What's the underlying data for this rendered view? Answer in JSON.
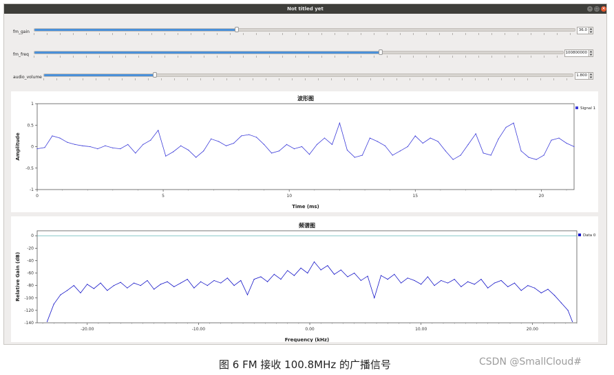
{
  "window": {
    "title": "Not titled yet"
  },
  "controls": [
    {
      "label": "fm_gain",
      "value": "36.0",
      "fraction": 0.374
    },
    {
      "label": "fm_freq",
      "value": "100800000",
      "fraction": 0.655
    },
    {
      "label": "audio_volume",
      "value": "1.800",
      "fraction": 0.209
    }
  ],
  "chart_data": [
    {
      "type": "line",
      "title": "波形图",
      "xlabel": "Time (ms)",
      "ylabel": "Amplitude",
      "xlim": [
        0,
        21.3
      ],
      "ylim": [
        -1,
        1
      ],
      "xticks": [
        0,
        5,
        10,
        15,
        20
      ],
      "yticks": [
        1,
        0.5,
        0,
        -0.5,
        -1
      ],
      "ytick_labels": [
        "1",
        "0.5",
        "0",
        "-0.5",
        "-1"
      ],
      "legend": "Signal 1",
      "legend_position": "top-right",
      "grid": false,
      "series": [
        {
          "name": "Signal 1",
          "color": "#3b3bd9",
          "x": [
            0,
            0.3,
            0.6,
            0.9,
            1.2,
            1.5,
            1.8,
            2.1,
            2.4,
            2.7,
            3,
            3.3,
            3.6,
            3.9,
            4.2,
            4.5,
            4.8,
            5.1,
            5.4,
            5.7,
            6,
            6.3,
            6.6,
            6.9,
            7.2,
            7.5,
            7.8,
            8.1,
            8.4,
            8.7,
            9,
            9.3,
            9.6,
            9.9,
            10.2,
            10.5,
            10.8,
            11.1,
            11.4,
            11.7,
            12,
            12.3,
            12.6,
            12.9,
            13.2,
            13.5,
            13.8,
            14.1,
            14.4,
            14.7,
            15,
            15.3,
            15.6,
            15.9,
            16.2,
            16.5,
            16.8,
            17.1,
            17.4,
            17.7,
            18,
            18.3,
            18.6,
            18.9,
            19.2,
            19.5,
            19.8,
            20.1,
            20.4,
            20.7,
            21,
            21.3
          ],
          "values": [
            -0.05,
            -0.02,
            0.25,
            0.2,
            0.1,
            0.05,
            0.02,
            0.0,
            -0.05,
            0.02,
            -0.03,
            -0.05,
            0.05,
            -0.15,
            0.05,
            0.15,
            0.38,
            -0.22,
            -0.12,
            0.02,
            -0.08,
            -0.25,
            -0.1,
            0.18,
            0.12,
            0.02,
            0.08,
            0.25,
            0.28,
            0.22,
            0.05,
            -0.15,
            -0.1,
            0.05,
            -0.05,
            0.0,
            -0.18,
            0.05,
            0.2,
            0.05,
            0.55,
            -0.08,
            -0.25,
            -0.2,
            0.2,
            0.12,
            0.02,
            -0.2,
            -0.1,
            0.0,
            0.25,
            0.08,
            0.2,
            0.12,
            -0.1,
            -0.3,
            -0.2,
            0.05,
            0.3,
            -0.15,
            -0.2,
            0.18,
            0.45,
            0.55,
            -0.1,
            -0.25,
            -0.3,
            -0.2,
            0.15,
            0.2,
            0.08,
            0.0
          ]
        }
      ]
    },
    {
      "type": "line",
      "title": "频谱图",
      "xlabel": "Frequency (kHz)",
      "ylabel": "Relative Gain (dB)",
      "xlim": [
        -24.5,
        24
      ],
      "ylim": [
        -140,
        8
      ],
      "xticks": [
        -20,
        -10,
        0,
        10,
        20
      ],
      "xtick_labels": [
        "-20.00",
        "-10.00",
        "0.00",
        "10.00",
        "20.00"
      ],
      "yticks": [
        0,
        -20,
        -40,
        -60,
        -80,
        -100,
        -120,
        -140
      ],
      "ytick_labels": [
        "0",
        "-20",
        "-40",
        "-60",
        "-80",
        "-100",
        "-120",
        "-140"
      ],
      "legend": "Data 0",
      "legend_position": "top-right",
      "reference_line": 0,
      "grid": false,
      "series": [
        {
          "name": "Data 0",
          "color": "#1515c8",
          "x": [
            -23.6,
            -23,
            -22.4,
            -21.8,
            -21.2,
            -20.6,
            -20,
            -19.4,
            -18.8,
            -18.2,
            -17.6,
            -17,
            -16.4,
            -15.8,
            -15.2,
            -14.6,
            -14,
            -13.4,
            -12.8,
            -12.2,
            -11.6,
            -11,
            -10.4,
            -9.8,
            -9.2,
            -8.6,
            -8,
            -7.4,
            -6.8,
            -6.2,
            -5.6,
            -5,
            -4.4,
            -3.8,
            -3.2,
            -2.6,
            -2,
            -1.4,
            -0.8,
            -0.2,
            0.4,
            1,
            1.6,
            2.2,
            2.8,
            3.4,
            4,
            4.6,
            5.2,
            5.8,
            6.4,
            7,
            7.6,
            8.2,
            8.8,
            9.4,
            10,
            10.6,
            11.2,
            11.8,
            12.4,
            13,
            13.6,
            14.2,
            14.8,
            15.4,
            16,
            16.6,
            17.2,
            17.8,
            18.4,
            19,
            19.6,
            20.2,
            20.8,
            21.4,
            22,
            22.6,
            23.2,
            23.6
          ],
          "values": [
            -138,
            -110,
            -95,
            -88,
            -80,
            -92,
            -78,
            -85,
            -76,
            -88,
            -80,
            -75,
            -84,
            -76,
            -80,
            -72,
            -86,
            -78,
            -74,
            -82,
            -76,
            -70,
            -84,
            -74,
            -80,
            -72,
            -76,
            -68,
            -80,
            -72,
            -95,
            -70,
            -66,
            -74,
            -62,
            -70,
            -56,
            -64,
            -52,
            -60,
            -42,
            -55,
            -48,
            -62,
            -55,
            -66,
            -60,
            -72,
            -65,
            -100,
            -64,
            -70,
            -62,
            -76,
            -68,
            -72,
            -78,
            -66,
            -80,
            -72,
            -76,
            -70,
            -82,
            -74,
            -78,
            -70,
            -84,
            -76,
            -72,
            -82,
            -76,
            -88,
            -80,
            -84,
            -92,
            -86,
            -96,
            -108,
            -120,
            -138
          ]
        }
      ]
    }
  ],
  "caption": "图 6 FM 接收 100.8MHz 的广播信号",
  "watermark": "CSDN @SmallCloud#"
}
